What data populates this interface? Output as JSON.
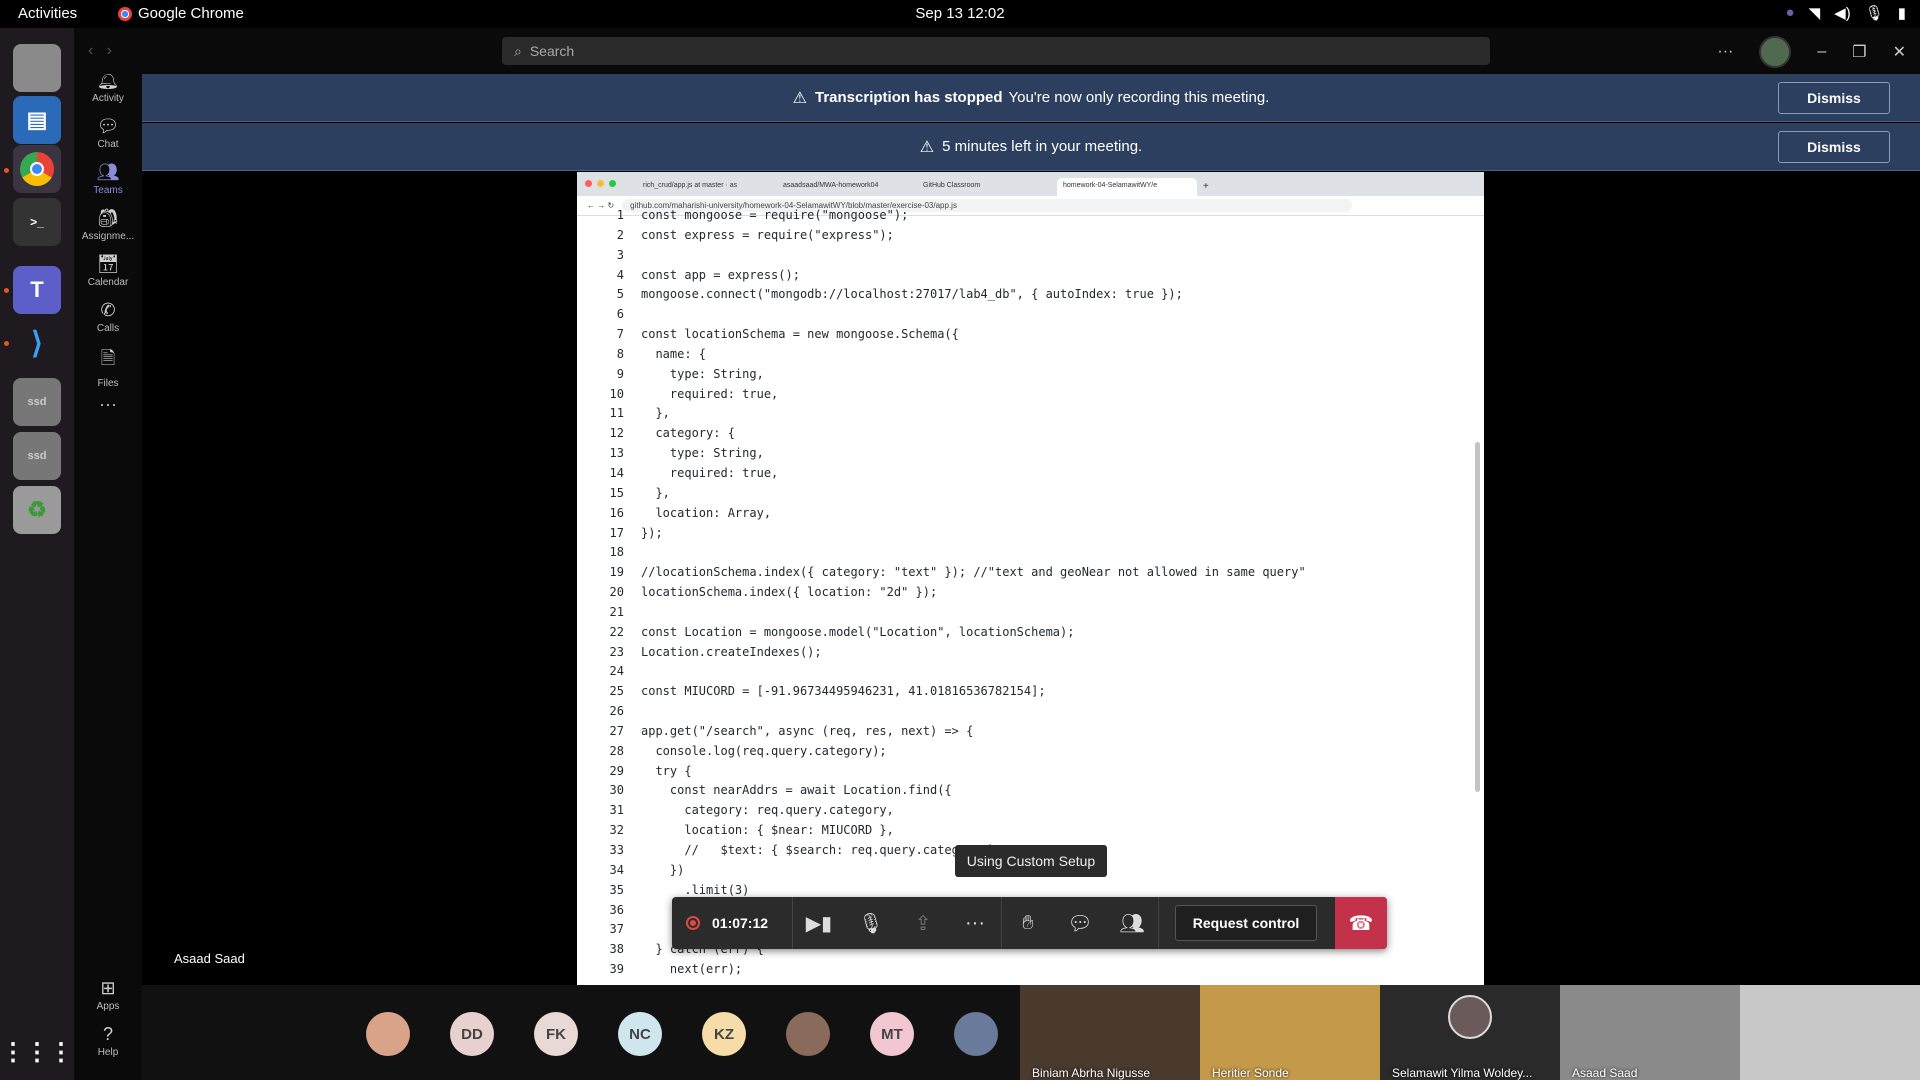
{
  "system": {
    "activities": "Activities",
    "app_name": "Google Chrome",
    "clock": "Sep 13  12:02"
  },
  "teams": {
    "search_placeholder": "Search",
    "rail": [
      {
        "label": "Activity",
        "icon": "bell-icon"
      },
      {
        "label": "Chat",
        "icon": "chat-icon"
      },
      {
        "label": "Teams",
        "icon": "teams-icon"
      },
      {
        "label": "Assignme...",
        "icon": "assignments-icon"
      },
      {
        "label": "Calendar",
        "icon": "calendar-icon"
      },
      {
        "label": "Calls",
        "icon": "phone-icon"
      },
      {
        "label": "Files",
        "icon": "file-icon"
      },
      {
        "label": "Apps",
        "icon": "apps-icon"
      },
      {
        "label": "Help",
        "icon": "help-icon"
      }
    ]
  },
  "banners": [
    {
      "bold": "Transcription has stopped",
      "text": "You're now only recording this meeting.",
      "button": "Dismiss"
    },
    {
      "bold": "",
      "text": "5 minutes left in your meeting.",
      "button": "Dismiss"
    }
  ],
  "shared_screen": {
    "tabs": [
      "rich_crud/app.js at master · as",
      "asaadsaad/MWA-homework04",
      "GitHub Classroom",
      "homework-04-SelamawitWY/e"
    ],
    "url": "github.com/maharishi-university/homework-04-SelamawitWY/blob/master/exercise-03/app.js",
    "presenter": "Asaad Saad",
    "code_lines": [
      {
        "n": "1",
        "t": "const mongoose = require(\"mongoose\");"
      },
      {
        "n": "2",
        "t": "const express = require(\"express\");"
      },
      {
        "n": "3",
        "t": ""
      },
      {
        "n": "4",
        "t": "const app = express();"
      },
      {
        "n": "5",
        "t": "mongoose.connect(\"mongodb://localhost:27017/lab4_db\", { autoIndex: true });"
      },
      {
        "n": "6",
        "t": ""
      },
      {
        "n": "7",
        "t": "const locationSchema = new mongoose.Schema({"
      },
      {
        "n": "8",
        "t": "  name: {"
      },
      {
        "n": "9",
        "t": "    type: String,"
      },
      {
        "n": "10",
        "t": "    required: true,"
      },
      {
        "n": "11",
        "t": "  },"
      },
      {
        "n": "12",
        "t": "  category: {"
      },
      {
        "n": "13",
        "t": "    type: String,"
      },
      {
        "n": "14",
        "t": "    required: true,"
      },
      {
        "n": "15",
        "t": "  },"
      },
      {
        "n": "16",
        "t": "  location: Array,"
      },
      {
        "n": "17",
        "t": "});"
      },
      {
        "n": "18",
        "t": ""
      },
      {
        "n": "19",
        "t": "//locationSchema.index({ category: \"text\" }); //\"text and geoNear not allowed in same query\""
      },
      {
        "n": "20",
        "t": "locationSchema.index({ location: \"2d\" });"
      },
      {
        "n": "21",
        "t": ""
      },
      {
        "n": "22",
        "t": "const Location = mongoose.model(\"Location\", locationSchema);"
      },
      {
        "n": "23",
        "t": "Location.createIndexes();"
      },
      {
        "n": "24",
        "t": ""
      },
      {
        "n": "25",
        "t": "const MIUCORD = [-91.96734495946231, 41.01816536782154];"
      },
      {
        "n": "26",
        "t": ""
      },
      {
        "n": "27",
        "t": "app.get(\"/search\", async (req, res, next) => {"
      },
      {
        "n": "28",
        "t": "  console.log(req.query.category);"
      },
      {
        "n": "29",
        "t": "  try {"
      },
      {
        "n": "30",
        "t": "    const nearAddrs = await Location.find({"
      },
      {
        "n": "31",
        "t": "      category: req.query.category,"
      },
      {
        "n": "32",
        "t": "      location: { $near: MIUCORD },"
      },
      {
        "n": "33",
        "t": "      //   $text: { $search: req.query.category }"
      },
      {
        "n": "34",
        "t": "    })"
      },
      {
        "n": "35",
        "t": "      .limit(3)"
      },
      {
        "n": "36",
        "t": ""
      },
      {
        "n": "37",
        "t": ""
      },
      {
        "n": "38",
        "t": "  } catch (err) {"
      },
      {
        "n": "39",
        "t": "    next(err);"
      }
    ]
  },
  "toolbar": {
    "timer": "01:07:12",
    "request_control": "Request control",
    "tooltip": "Using Custom Setup"
  },
  "participants": [
    {
      "initials": "",
      "color": "#d9a38a"
    },
    {
      "initials": "DD",
      "color": "#e8d0cf"
    },
    {
      "initials": "FK",
      "color": "#e8d8d6"
    },
    {
      "initials": "NC",
      "color": "#cfe6ef"
    },
    {
      "initials": "KZ",
      "color": "#f5dca8"
    },
    {
      "initials": "",
      "color": "#8a6a5a"
    },
    {
      "initials": "MT",
      "color": "#f2c7d2"
    },
    {
      "initials": "",
      "color": "#6a7a9a"
    }
  ],
  "video_tiles": [
    {
      "name": "Biniam Abrha Nigusse"
    },
    {
      "name": "Heritier Sonde"
    },
    {
      "name": "Selamawit Yilma Woldey..."
    },
    {
      "name": "Asaad Saad"
    },
    {
      "name": ""
    }
  ]
}
